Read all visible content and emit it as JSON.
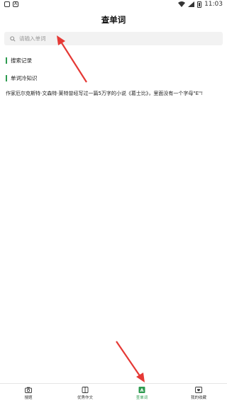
{
  "status_bar": {
    "time": "11:03"
  },
  "header": {
    "title": "查单词"
  },
  "search": {
    "placeholder": "请输入单词"
  },
  "sections": {
    "history_label": "搜索记录",
    "trivia_label": "单词冷知识",
    "trivia_text": "作家厄尔克斯特·文森特·莱特曾经写过一篇5万字的小说《葛士比》，里面没有一个字母\"E\"!"
  },
  "tabs": [
    {
      "label": "搜题",
      "icon": "camera-icon",
      "active": false
    },
    {
      "label": "优秀作文",
      "icon": "book-icon",
      "active": false
    },
    {
      "label": "查单词",
      "icon": "dictionary-icon",
      "active": true
    },
    {
      "label": "我的收藏",
      "icon": "favorites-icon",
      "active": false
    }
  ],
  "colors": {
    "accent": "#2e9b50",
    "annotation_arrow": "#e53935"
  }
}
